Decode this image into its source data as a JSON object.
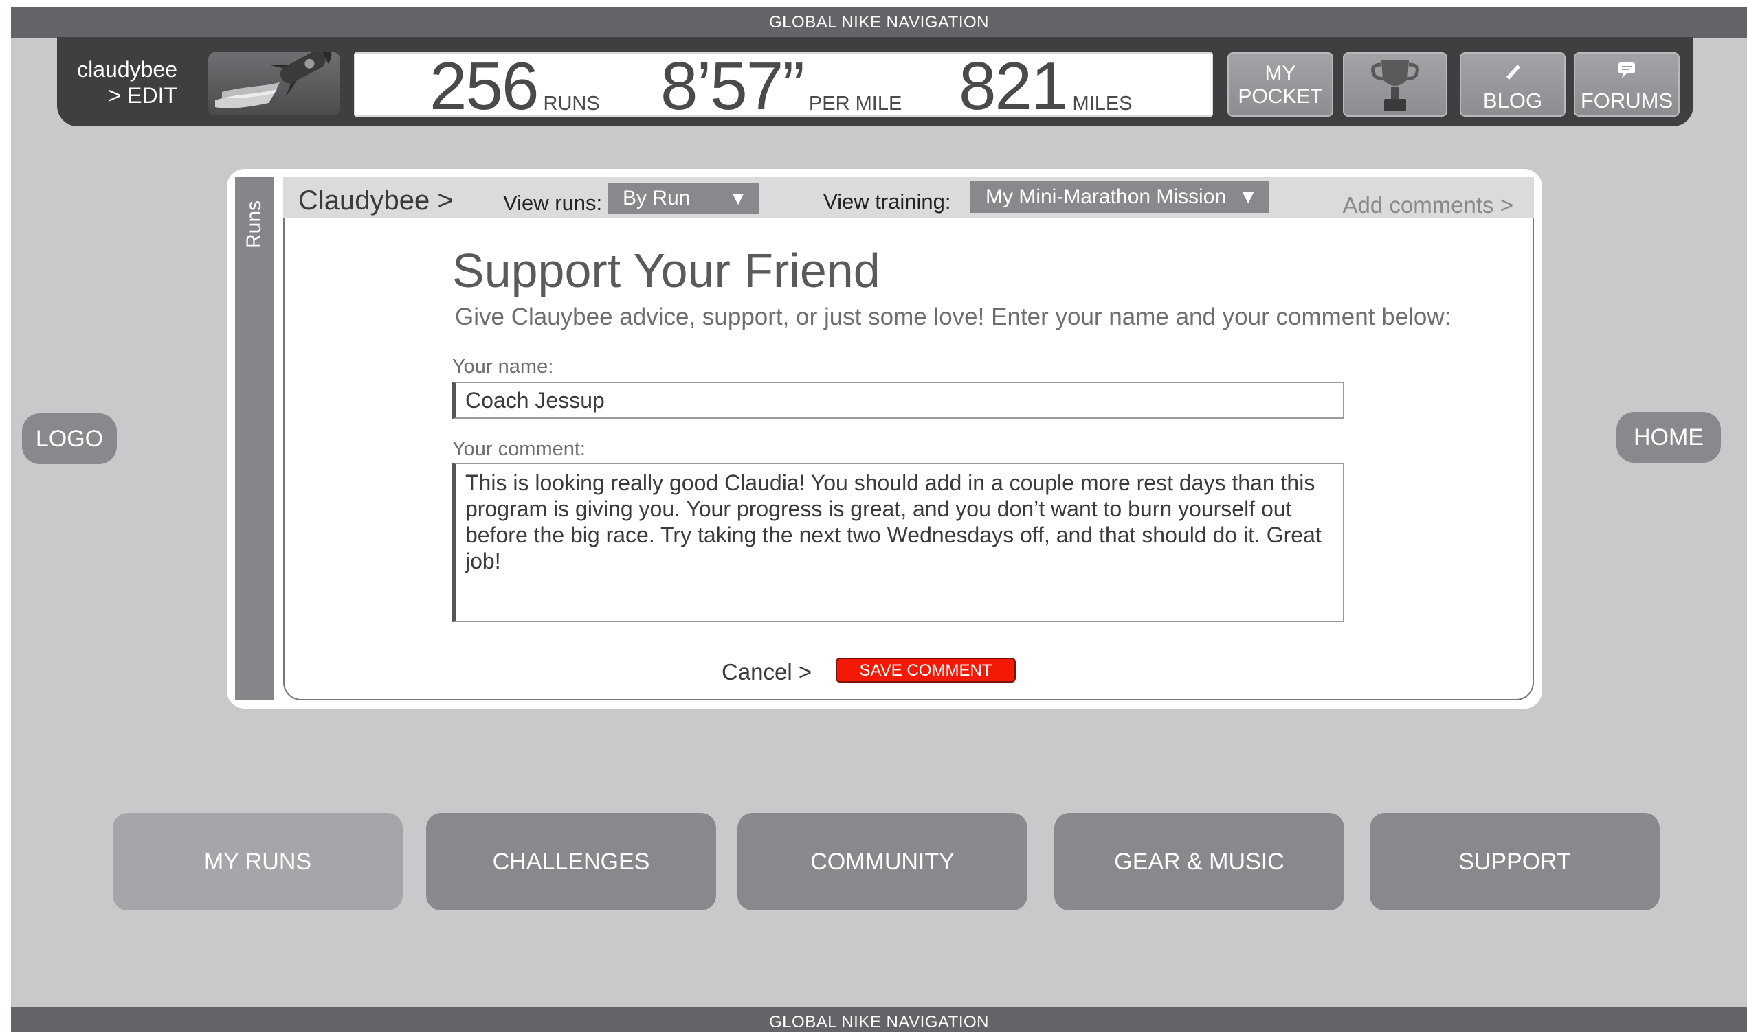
{
  "global_nav": {
    "top_label": "GLOBAL NIKE NAVIGATION",
    "bottom_label": "GLOBAL NIKE NAVIGATION"
  },
  "user": {
    "name": "claudybee",
    "edit_link": "> EDIT",
    "avatar_icon": "rocket-icon"
  },
  "stats": [
    {
      "value": "256",
      "unit": "RUNS"
    },
    {
      "value": "8’5 7”",
      "unit": "PER MILE"
    },
    {
      "value": "821",
      "unit": "MILES"
    }
  ],
  "header_buttons": {
    "pocket_line1": "MY",
    "pocket_line2": "POCKET",
    "trophy_icon": "trophy-icon",
    "blog_label": "BLOG",
    "blog_icon": "pencil-icon",
    "forums_label": "FORUMS",
    "forums_icon": "speech-bubble-icon"
  },
  "side": {
    "logo_label": "LOGO",
    "home_label": "HOME"
  },
  "card": {
    "tab_label": "Runs",
    "breadcrumb": "Claudybee >",
    "view_runs_label": "View runs:",
    "view_runs_value": "By Run",
    "view_training_label": "View training:",
    "view_training_value": "My Mini-Marathon Mission",
    "add_comments": "Add comments >",
    "title": "Support Your Friend",
    "subtitle": "Give Clauybee advice, support, or just some love! Enter your name and your comment below:",
    "name_label": "Your name:",
    "name_value": "Coach Jessup",
    "comment_label": "Your comment:",
    "comment_value": "This is looking really good Claudia! You should add in a couple more rest days than this program is giving you. Your progress is great, and you don’t want to burn yourself out before the big race. Try taking the next two Wednesdays off, and that should do it. Great job!",
    "cancel_label": "Cancel >",
    "save_label": "SAVE COMMENT"
  },
  "bottom_nav": [
    {
      "label": "MY RUNS",
      "active": true
    },
    {
      "label": "CHALLENGES",
      "active": false
    },
    {
      "label": "COMMUNITY",
      "active": false
    },
    {
      "label": "GEAR & MUSIC",
      "active": false
    },
    {
      "label": "SUPPORT",
      "active": false
    }
  ],
  "colors": {
    "accent_red": "#f21a07",
    "chrome_dark": "#3f3f41",
    "button_gray": "#88898c",
    "background": "#c8c9cb"
  }
}
